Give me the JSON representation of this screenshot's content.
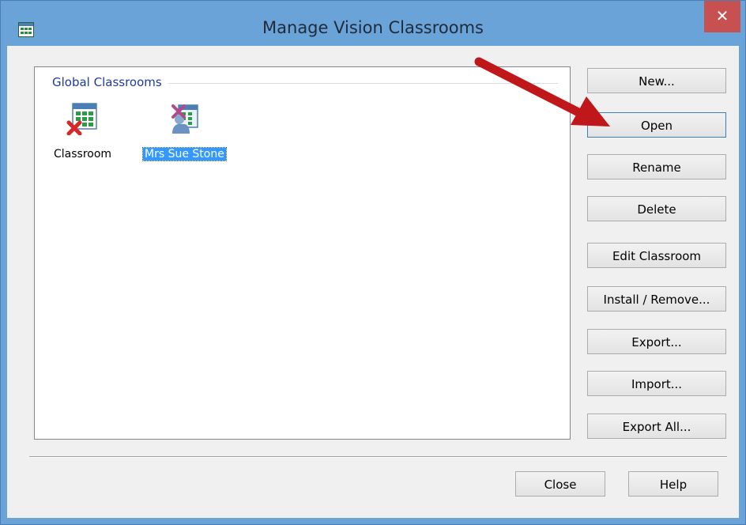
{
  "window": {
    "title": "Manage Vision Classrooms",
    "close_label": "✕",
    "accent_color": "#6aa3d8"
  },
  "list": {
    "group_label": "Global Classrooms",
    "items": [
      {
        "label": "Classroom",
        "icon": "classroom-grid-icon",
        "selected": false
      },
      {
        "label": "Mrs Sue Stone",
        "icon": "teacher-classroom-icon",
        "selected": true
      }
    ]
  },
  "buttons": {
    "new": "New...",
    "open": "Open",
    "rename": "Rename",
    "delete": "Delete",
    "edit_classroom": "Edit Classroom",
    "install_remove": "Install / Remove...",
    "export": "Export...",
    "import": "Import...",
    "export_all": "Export All...",
    "close": "Close",
    "help": "Help"
  },
  "annotation": {
    "arrow_color": "#c0171b"
  }
}
